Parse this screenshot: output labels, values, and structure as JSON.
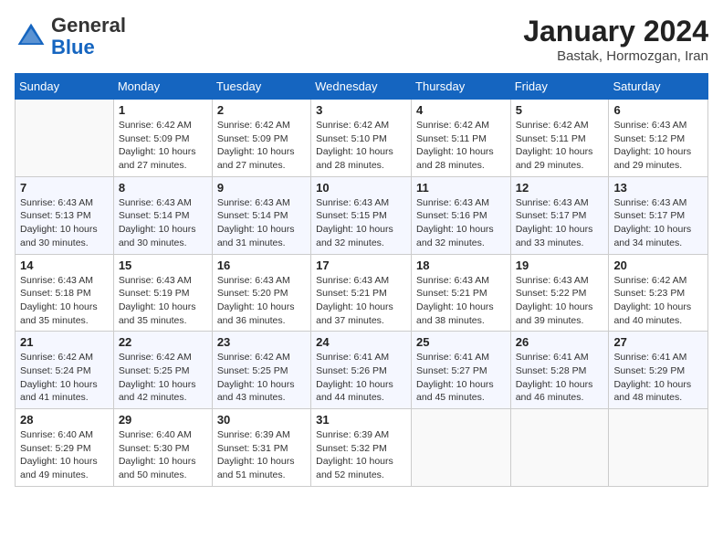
{
  "logo": {
    "general": "General",
    "blue": "Blue"
  },
  "title": "January 2024",
  "subtitle": "Bastak, Hormozgan, Iran",
  "days_header": [
    "Sunday",
    "Monday",
    "Tuesday",
    "Wednesday",
    "Thursday",
    "Friday",
    "Saturday"
  ],
  "weeks": [
    [
      {
        "num": "",
        "info": ""
      },
      {
        "num": "1",
        "info": "Sunrise: 6:42 AM\nSunset: 5:09 PM\nDaylight: 10 hours\nand 27 minutes."
      },
      {
        "num": "2",
        "info": "Sunrise: 6:42 AM\nSunset: 5:09 PM\nDaylight: 10 hours\nand 27 minutes."
      },
      {
        "num": "3",
        "info": "Sunrise: 6:42 AM\nSunset: 5:10 PM\nDaylight: 10 hours\nand 28 minutes."
      },
      {
        "num": "4",
        "info": "Sunrise: 6:42 AM\nSunset: 5:11 PM\nDaylight: 10 hours\nand 28 minutes."
      },
      {
        "num": "5",
        "info": "Sunrise: 6:42 AM\nSunset: 5:11 PM\nDaylight: 10 hours\nand 29 minutes."
      },
      {
        "num": "6",
        "info": "Sunrise: 6:43 AM\nSunset: 5:12 PM\nDaylight: 10 hours\nand 29 minutes."
      }
    ],
    [
      {
        "num": "7",
        "info": "Sunrise: 6:43 AM\nSunset: 5:13 PM\nDaylight: 10 hours\nand 30 minutes."
      },
      {
        "num": "8",
        "info": "Sunrise: 6:43 AM\nSunset: 5:14 PM\nDaylight: 10 hours\nand 30 minutes."
      },
      {
        "num": "9",
        "info": "Sunrise: 6:43 AM\nSunset: 5:14 PM\nDaylight: 10 hours\nand 31 minutes."
      },
      {
        "num": "10",
        "info": "Sunrise: 6:43 AM\nSunset: 5:15 PM\nDaylight: 10 hours\nand 32 minutes."
      },
      {
        "num": "11",
        "info": "Sunrise: 6:43 AM\nSunset: 5:16 PM\nDaylight: 10 hours\nand 32 minutes."
      },
      {
        "num": "12",
        "info": "Sunrise: 6:43 AM\nSunset: 5:17 PM\nDaylight: 10 hours\nand 33 minutes."
      },
      {
        "num": "13",
        "info": "Sunrise: 6:43 AM\nSunset: 5:17 PM\nDaylight: 10 hours\nand 34 minutes."
      }
    ],
    [
      {
        "num": "14",
        "info": "Sunrise: 6:43 AM\nSunset: 5:18 PM\nDaylight: 10 hours\nand 35 minutes."
      },
      {
        "num": "15",
        "info": "Sunrise: 6:43 AM\nSunset: 5:19 PM\nDaylight: 10 hours\nand 35 minutes."
      },
      {
        "num": "16",
        "info": "Sunrise: 6:43 AM\nSunset: 5:20 PM\nDaylight: 10 hours\nand 36 minutes."
      },
      {
        "num": "17",
        "info": "Sunrise: 6:43 AM\nSunset: 5:21 PM\nDaylight: 10 hours\nand 37 minutes."
      },
      {
        "num": "18",
        "info": "Sunrise: 6:43 AM\nSunset: 5:21 PM\nDaylight: 10 hours\nand 38 minutes."
      },
      {
        "num": "19",
        "info": "Sunrise: 6:43 AM\nSunset: 5:22 PM\nDaylight: 10 hours\nand 39 minutes."
      },
      {
        "num": "20",
        "info": "Sunrise: 6:42 AM\nSunset: 5:23 PM\nDaylight: 10 hours\nand 40 minutes."
      }
    ],
    [
      {
        "num": "21",
        "info": "Sunrise: 6:42 AM\nSunset: 5:24 PM\nDaylight: 10 hours\nand 41 minutes."
      },
      {
        "num": "22",
        "info": "Sunrise: 6:42 AM\nSunset: 5:25 PM\nDaylight: 10 hours\nand 42 minutes."
      },
      {
        "num": "23",
        "info": "Sunrise: 6:42 AM\nSunset: 5:25 PM\nDaylight: 10 hours\nand 43 minutes."
      },
      {
        "num": "24",
        "info": "Sunrise: 6:41 AM\nSunset: 5:26 PM\nDaylight: 10 hours\nand 44 minutes."
      },
      {
        "num": "25",
        "info": "Sunrise: 6:41 AM\nSunset: 5:27 PM\nDaylight: 10 hours\nand 45 minutes."
      },
      {
        "num": "26",
        "info": "Sunrise: 6:41 AM\nSunset: 5:28 PM\nDaylight: 10 hours\nand 46 minutes."
      },
      {
        "num": "27",
        "info": "Sunrise: 6:41 AM\nSunset: 5:29 PM\nDaylight: 10 hours\nand 48 minutes."
      }
    ],
    [
      {
        "num": "28",
        "info": "Sunrise: 6:40 AM\nSunset: 5:29 PM\nDaylight: 10 hours\nand 49 minutes."
      },
      {
        "num": "29",
        "info": "Sunrise: 6:40 AM\nSunset: 5:30 PM\nDaylight: 10 hours\nand 50 minutes."
      },
      {
        "num": "30",
        "info": "Sunrise: 6:39 AM\nSunset: 5:31 PM\nDaylight: 10 hours\nand 51 minutes."
      },
      {
        "num": "31",
        "info": "Sunrise: 6:39 AM\nSunset: 5:32 PM\nDaylight: 10 hours\nand 52 minutes."
      },
      {
        "num": "",
        "info": ""
      },
      {
        "num": "",
        "info": ""
      },
      {
        "num": "",
        "info": ""
      }
    ]
  ]
}
